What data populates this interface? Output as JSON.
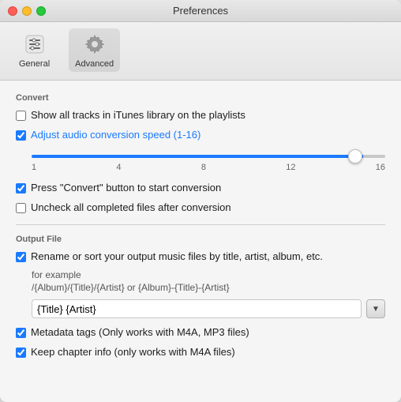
{
  "window": {
    "title": "Preferences"
  },
  "toolbar": {
    "general": {
      "label": "General",
      "active": false
    },
    "advanced": {
      "label": "Advanced",
      "active": true
    }
  },
  "convert_section": {
    "header": "Convert",
    "show_tracks": {
      "label": "Show all tracks in iTunes library on the playlists",
      "checked": false
    },
    "adjust_speed": {
      "label": "Adjust audio conversion speed (1-16)",
      "checked": true,
      "slider": {
        "min": 1,
        "max": 16,
        "value": 15,
        "labels": [
          "1",
          "4",
          "8",
          "12",
          "16"
        ]
      }
    },
    "press_convert": {
      "label": "Press \"Convert\" button to start conversion",
      "checked": true
    },
    "uncheck_completed": {
      "label": "Uncheck all completed files after conversion",
      "checked": false
    }
  },
  "output_section": {
    "header": "Output File",
    "rename_sort": {
      "label": "Rename or sort your output music files by title, artist, album, etc.",
      "checked": true,
      "example_label": "for example",
      "example_path": "/{Album}/{Title}/{Artist} or {Album}-{Title}-{Artist}"
    },
    "format_input": {
      "placeholder": "{Title} {Artist}",
      "value": "{Title} {Artist}"
    },
    "dropdown_arrow": "▼",
    "metadata_tags": {
      "label": "Metadata tags (Only works with M4A, MP3 files)",
      "checked": true
    },
    "keep_chapter": {
      "label": "Keep chapter info (only works with  M4A files)",
      "checked": true
    }
  }
}
